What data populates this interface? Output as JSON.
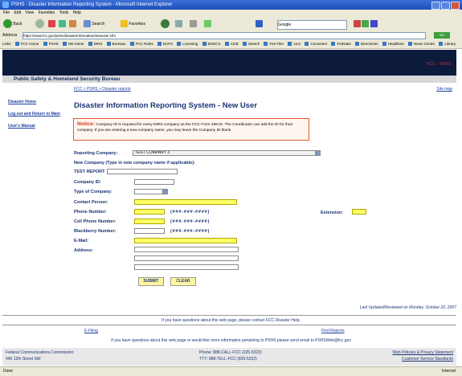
{
  "window": {
    "title": "PSHS - Disaster Information Reporting System - Microsoft Internet Explorer",
    "controls": [
      "minimize",
      "maximize",
      "close"
    ]
  },
  "menubar": [
    "File",
    "Edit",
    "View",
    "Favorites",
    "Tools",
    "Help"
  ],
  "toolbar": {
    "back_label": "Back",
    "search_label": "Search",
    "favorites_label": "Favorites",
    "search_box_placeholder": "Google"
  },
  "address": {
    "label": "Address",
    "url": "https://www.fcc.gov/pshs/disasterinformation/newuser.cfm",
    "go_label": "Go"
  },
  "links_bar": {
    "label": "Links",
    "items": [
      "FCC Home",
      "PSHS",
      "EB Home",
      "DIRS",
      "Bureaus",
      "FCC Rules",
      "ECFS",
      "Licensing",
      "EDOCS",
      "CGB",
      "Search",
      "Fee Filer",
      "ULS",
      "Consumer",
      "Fedstats",
      "Directories",
      "Headlines",
      "News Center",
      "Library"
    ]
  },
  "banner": {
    "tagline": "FCC / DIRS"
  },
  "bureau_title": "Public Safety & Homeland Security Bureau",
  "breadcrumb": "FCC > PSHS > Disaster reports",
  "site_map": "Site map",
  "sidebar": {
    "items": [
      "Disaster Home",
      "Log out and Return to Main",
      "User's Manual"
    ]
  },
  "page_title": "Disaster Information Reporting System - New User",
  "notice": {
    "heading": "Notice:",
    "text": "Company ID is required for every DIRS company as the FCC Form 499 ID. The Coordinator can add the ID for their company. If you are entering a new company name, you may leave the Company ID blank."
  },
  "form": {
    "reporting_company_label": "Reporting Company:",
    "reporting_company_value": "TEST COMPANY 3",
    "new_company_label": "New Company (Type in new company name if applicable):",
    "test_report_label": "TEST REPORT",
    "company_id_label": "Company ID:",
    "type_of_company_label": "Type of Company:",
    "contact_person_label": "Contact Person:",
    "phone_label": "Phone Number:",
    "phone_format": "(###-###-####)",
    "cell_label": "Cell Phone Number:",
    "cell_format": "(###-###-####)",
    "blackberry_label": "Blackberry Number:",
    "blackberry_format": "(###-###-####)",
    "extension_label": "Extension:",
    "email_label": "E-Mail:",
    "address_label": "Address:",
    "submit_label": "SUBMIT",
    "clear_label": "CLEAR"
  },
  "updated": "Last Updated/Reviewed on Monday, October 22, 2007",
  "contact_line": "If you have questions about this web page, please contact FCC Disaster Help.",
  "footer_links": [
    "E-Filing",
    "Find Reports"
  ],
  "feedback_line": "If you have questions about this web page or would like more information pertaining to PSHS please send email to PSHSWeb@fcc.gov",
  "footer": {
    "org": "Federal Communications Commission",
    "address": "445 12th Street SW",
    "phone": "Phone: 888-CALL-FCC (225-5322)",
    "tty": "TTY: 888-TELL-FCC (835-5322)",
    "privacy": "Web Policies & Privacy Statement",
    "quality": "Customer Service Standards"
  },
  "status": {
    "text": "Done",
    "zone": "Internet"
  },
  "colors": {
    "banner": "#0c1a3c",
    "accent_text": "#1a3476",
    "required_field": "#ffff66",
    "notice_border": "#e05a2a"
  }
}
